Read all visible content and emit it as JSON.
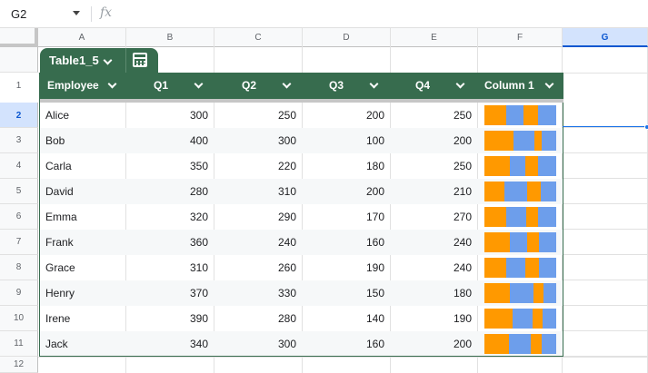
{
  "name_box": {
    "value": "G2"
  },
  "formula_bar": {
    "fx_label": "fx",
    "value": ""
  },
  "columns": [
    "A",
    "B",
    "C",
    "D",
    "E",
    "F",
    "G"
  ],
  "active_column": "G",
  "rows": [
    "1",
    "2",
    "3",
    "4",
    "5",
    "6",
    "7",
    "8",
    "9",
    "10",
    "11",
    "12"
  ],
  "active_row": "2",
  "table": {
    "name": "Table1_5",
    "header_color": "#376c4e",
    "headers": [
      "Employee",
      "Q1",
      "Q2",
      "Q3",
      "Q4",
      "Column 1"
    ],
    "records": [
      {
        "employee": "Alice",
        "q1": 300,
        "q2": 250,
        "q3": 200,
        "q4": 250
      },
      {
        "employee": "Bob",
        "q1": 400,
        "q2": 300,
        "q3": 100,
        "q4": 200
      },
      {
        "employee": "Carla",
        "q1": 350,
        "q2": 220,
        "q3": 180,
        "q4": 250
      },
      {
        "employee": "David",
        "q1": 280,
        "q2": 310,
        "q3": 200,
        "q4": 210
      },
      {
        "employee": "Emma",
        "q1": 320,
        "q2": 290,
        "q3": 170,
        "q4": 270
      },
      {
        "employee": "Frank",
        "q1": 360,
        "q2": 240,
        "q3": 160,
        "q4": 240
      },
      {
        "employee": "Grace",
        "q1": 310,
        "q2": 260,
        "q3": 190,
        "q4": 240
      },
      {
        "employee": "Henry",
        "q1": 370,
        "q2": 330,
        "q3": 150,
        "q4": 180
      },
      {
        "employee": "Irene",
        "q1": 390,
        "q2": 280,
        "q3": 140,
        "q4": 190
      },
      {
        "employee": "Jack",
        "q1": 340,
        "q2": 300,
        "q3": 160,
        "q4": 200
      }
    ]
  },
  "sparkline": {
    "type": "stacked-bar",
    "colors": [
      "#ff9900",
      "#6d9eeb"
    ]
  }
}
